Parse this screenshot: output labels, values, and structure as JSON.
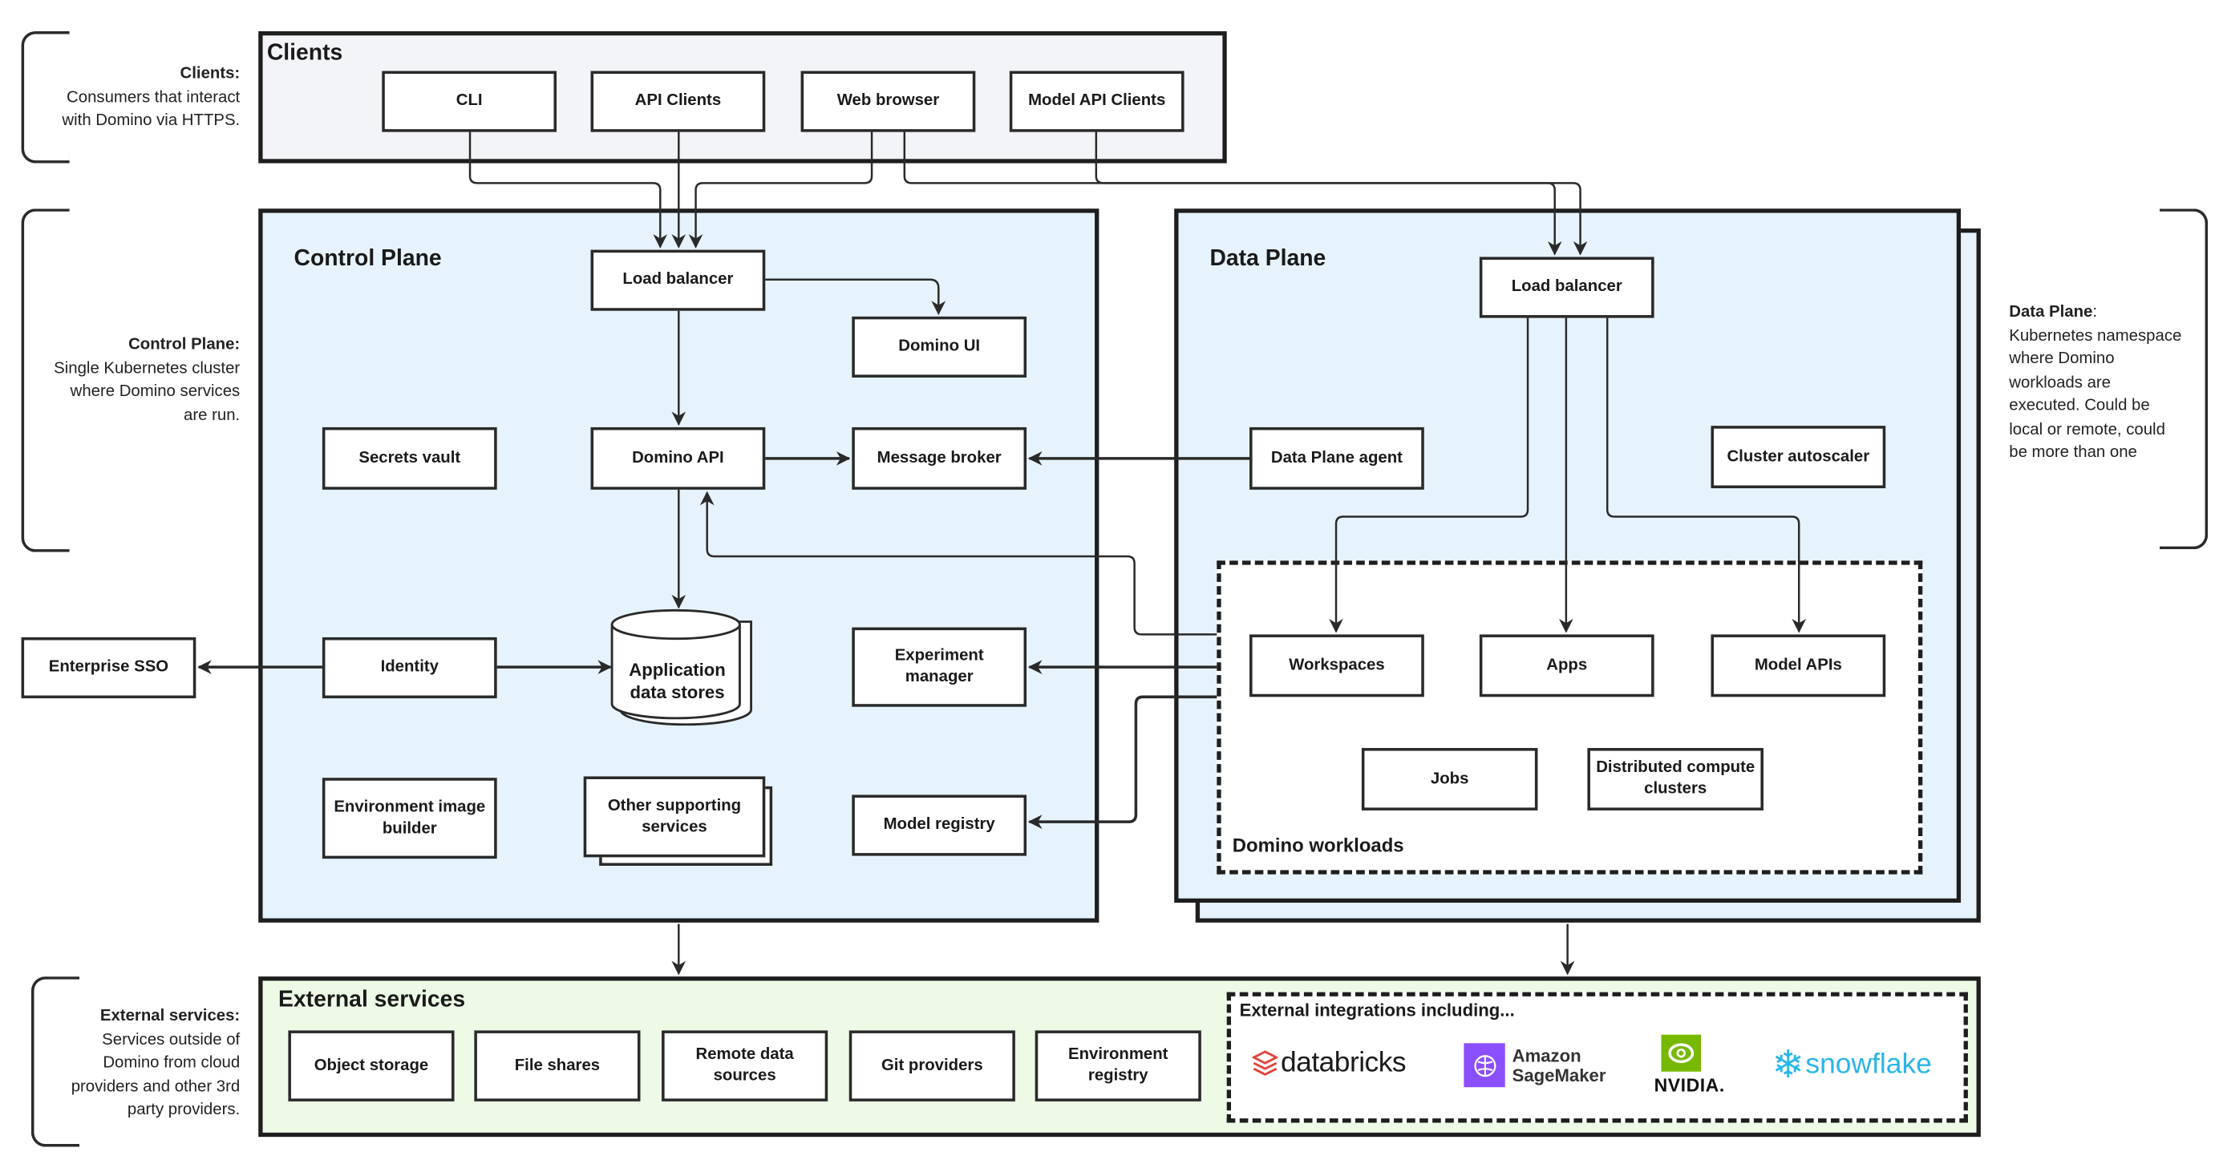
{
  "notes": {
    "clients": {
      "title": "Clients:",
      "lines": [
        "Consumers that interact",
        "with Domino via HTTPS."
      ]
    },
    "control_plane": {
      "title": "Control Plane:",
      "lines": [
        "Single Kubernetes cluster",
        "where Domino services",
        "are run."
      ]
    },
    "data_plane": {
      "title": "Data Plane",
      "colon": ":",
      "lines": [
        "Kubernetes namespace",
        "where Domino",
        "workloads are",
        "executed. Could be",
        "local or remote, could",
        "be more than one"
      ]
    },
    "external": {
      "title": "External services:",
      "lines": [
        "Services outside of",
        "Domino from cloud",
        "providers and other 3rd",
        "party providers."
      ]
    }
  },
  "clients": {
    "title": "Clients",
    "items": [
      "CLI",
      "API Clients",
      "Web browser",
      "Model API Clients"
    ]
  },
  "control_plane": {
    "title": "Control Plane",
    "load_balancer": "Load balancer",
    "domino_ui": "Domino UI",
    "secrets_vault": "Secrets vault",
    "domino_api": "Domino API",
    "message_broker": "Message broker",
    "identity": "Identity",
    "app_data_stores": [
      "Application",
      "data stores"
    ],
    "experiment_manager": [
      "Experiment",
      "manager"
    ],
    "env_image_builder": [
      "Environment image",
      "builder"
    ],
    "other_services": [
      "Other supporting",
      "services"
    ],
    "model_registry": "Model registry"
  },
  "enterprise_sso": "Enterprise SSO",
  "data_plane": {
    "title": "Data Plane",
    "load_balancer": "Load balancer",
    "agent": "Data Plane agent",
    "autoscaler": "Cluster autoscaler",
    "workloads": {
      "title": "Domino workloads",
      "items": {
        "workspaces": "Workspaces",
        "apps": "Apps",
        "model_apis": "Model APIs",
        "jobs": "Jobs",
        "distributed": [
          "Distributed compute",
          "clusters"
        ]
      }
    }
  },
  "external": {
    "title": "External services",
    "items": [
      [
        "Object storage"
      ],
      [
        "File shares"
      ],
      [
        "Remote data",
        "sources"
      ],
      [
        "Git providers"
      ],
      [
        "Environment",
        "registry"
      ]
    ],
    "integrations": {
      "title": "External integrations including...",
      "logos": [
        {
          "name": "databricks",
          "text": "databricks",
          "color": "#e0443a"
        },
        {
          "name": "sagemaker",
          "text": [
            "Amazon",
            "SageMaker"
          ],
          "color": "#8c4fff"
        },
        {
          "name": "nvidia",
          "text": "NVIDIA.",
          "color": "#76b900"
        },
        {
          "name": "snowflake",
          "text": "snowflake",
          "color": "#29b5e8"
        }
      ]
    }
  },
  "colors": {
    "clients_bg": "#f3f4f8",
    "plane_bg": "#e6f3fc",
    "external_bg": "#edfbe6",
    "line": "#2a2a2a"
  }
}
